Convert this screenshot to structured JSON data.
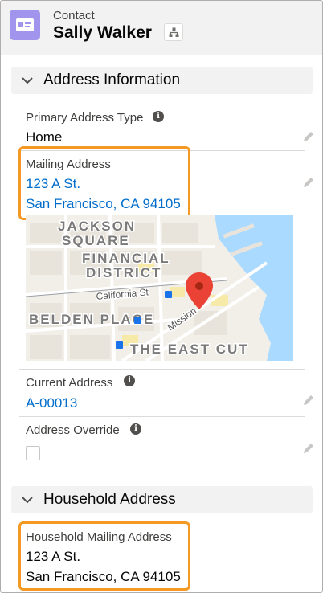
{
  "header": {
    "object_label": "Contact",
    "record_name": "Sally Walker"
  },
  "sections": {
    "address": {
      "title": "Address Information"
    },
    "household": {
      "title": "Household Address"
    }
  },
  "fields": {
    "primary_address_type": {
      "label": "Primary Address Type",
      "value": "Home"
    },
    "mailing_address": {
      "label": "Mailing Address",
      "line1": "123 A St.",
      "line2": "San Francisco, CA 94105"
    },
    "current_address": {
      "label": "Current Address",
      "value": "A-00013"
    },
    "address_override": {
      "label": "Address Override",
      "checked": false
    },
    "household_mailing_address": {
      "label": "Household Mailing Address",
      "line1": "123 A St.",
      "line2": "San Francisco, CA 94105"
    }
  },
  "map": {
    "labels": {
      "jackson": "JACKSON",
      "square": "SQUARE",
      "financial": "FINANCIAL",
      "district": "DISTRICT",
      "california": "California St",
      "belden": "BELDEN PLACE",
      "mission": "Mission",
      "east_cut": "THE EAST CUT"
    },
    "colors": {
      "water": "#aadaff",
      "land": "#f2efe9",
      "block": "#e8e4dc",
      "road": "#ffffff",
      "park": "#c8e6c9",
      "pin": "#ea4335"
    }
  },
  "icons": {
    "info": "i",
    "contact": "contact-card-icon",
    "hierarchy": "hierarchy-icon",
    "chevron": "chevron-down-icon",
    "pencil": "pencil-icon"
  },
  "colors": {
    "highlight": "#f49a24",
    "link": "#006dcc",
    "contact_icon_bg": "#a094ed"
  }
}
